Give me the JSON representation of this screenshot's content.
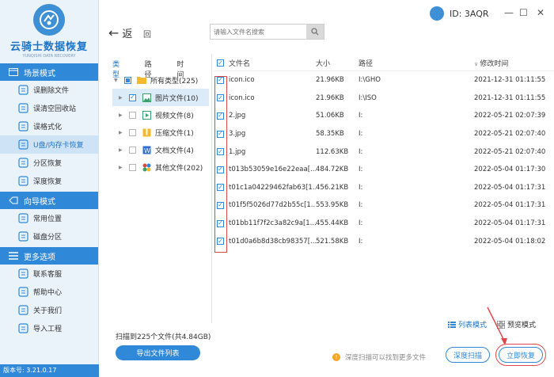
{
  "app": {
    "title": "云骑士数据恢复",
    "subtitle": "YUNQISHI DATA RECOVERY",
    "version": "版本号: 3.21.0.17",
    "account_id": "ID: 3AQR"
  },
  "colors": {
    "accent": "#2f88d8",
    "sidebar_bg": "#eaf2fa",
    "highlight": "#e04848"
  },
  "sidebar": {
    "sections": [
      {
        "header": "场景模式",
        "icon": "scene-icon",
        "items": [
          {
            "label": "误删除文件",
            "icon": "delete-file-icon",
            "active": false
          },
          {
            "label": "误清空回收站",
            "icon": "recycle-bin-icon",
            "active": false
          },
          {
            "label": "误格式化",
            "icon": "format-icon",
            "active": false
          },
          {
            "label": "U盘/内存卡恢复",
            "icon": "usb-icon",
            "active": true
          },
          {
            "label": "分区恢复",
            "icon": "partition-icon",
            "active": false
          },
          {
            "label": "深度恢复",
            "icon": "deep-recovery-icon",
            "active": false
          }
        ]
      },
      {
        "header": "向导模式",
        "icon": "guide-icon",
        "items": [
          {
            "label": "常用位置",
            "icon": "location-icon",
            "active": false
          },
          {
            "label": "磁盘分区",
            "icon": "disk-icon",
            "active": false
          }
        ]
      },
      {
        "header": "更多选项",
        "icon": "more-icon",
        "items": [
          {
            "label": "联系客服",
            "icon": "support-icon",
            "active": false
          },
          {
            "label": "帮助中心",
            "icon": "help-icon",
            "active": false
          },
          {
            "label": "关于我们",
            "icon": "about-icon",
            "active": false
          },
          {
            "label": "导入工程",
            "icon": "import-icon",
            "active": false
          }
        ]
      }
    ]
  },
  "toolbar": {
    "back_label": "返",
    "home_label": "回",
    "search_placeholder": "请输入文件名搜索"
  },
  "tree": {
    "tabs": [
      "类型",
      "路径",
      "时间"
    ],
    "items": [
      {
        "label": "所有类型(225)",
        "icon": "folder-icon",
        "level": 0,
        "state": "partial",
        "selected": false
      },
      {
        "label": "图片文件(10)",
        "icon": "image-icon",
        "level": 1,
        "state": "checked",
        "selected": true
      },
      {
        "label": "视频文件(8)",
        "icon": "video-icon",
        "level": 1,
        "state": "unchecked",
        "selected": false
      },
      {
        "label": "压缩文件(1)",
        "icon": "archive-icon",
        "level": 1,
        "state": "unchecked",
        "selected": false
      },
      {
        "label": "文档文件(4)",
        "icon": "document-icon",
        "level": 1,
        "state": "unchecked",
        "selected": false
      },
      {
        "label": "其他文件(202)",
        "icon": "other-files-icon",
        "level": 1,
        "state": "unchecked",
        "selected": false
      }
    ]
  },
  "table": {
    "columns": {
      "name": "文件名",
      "size": "大小",
      "path": "路径",
      "time": "修改时间"
    },
    "rows": [
      {
        "name": "icon.ico",
        "size": "21.96KB",
        "path": "I:\\GHO",
        "time": "2021-12-31 01:11:55"
      },
      {
        "name": "icon.ico",
        "size": "21.96KB",
        "path": "I:\\ISO",
        "time": "2021-12-31 01:11:55"
      },
      {
        "name": "2.jpg",
        "size": "51.06KB",
        "path": "I:",
        "time": "2022-05-21 02:07:39"
      },
      {
        "name": "3.jpg",
        "size": "58.35KB",
        "path": "I:",
        "time": "2022-05-21 02:07:40"
      },
      {
        "name": "1.jpg",
        "size": "112.63KB",
        "path": "I:",
        "time": "2022-05-21 02:07:40"
      },
      {
        "name": "t013b53059e16e22eaa[...",
        "size": "484.72KB",
        "path": "I:",
        "time": "2022-05-04 01:17:30"
      },
      {
        "name": "t01c1a04229462fab63[1...",
        "size": "456.21KB",
        "path": "I:",
        "time": "2022-05-04 01:17:31"
      },
      {
        "name": "t01f5f5026d77d2b55c[1...",
        "size": "553.95KB",
        "path": "I:",
        "time": "2022-05-04 01:17:31"
      },
      {
        "name": "t01bb11f7f2c3a82c9a[1...",
        "size": "455.44KB",
        "path": "I:",
        "time": "2022-05-04 01:17:31"
      },
      {
        "name": "t01d0a6b8d38cb98357[...",
        "size": "521.58KB",
        "path": "I:",
        "time": "2022-05-04 01:18:02"
      }
    ]
  },
  "footer": {
    "summary": "扫描到225个文件(共4.84GB)",
    "export_label": "导出文件列表",
    "list_mode_label": "列表模式",
    "preview_mode_label": "预览模式",
    "hint": "深度扫描可以找到更多文件",
    "deep_scan_label": "深度扫描",
    "recover_label": "立即恢复"
  }
}
